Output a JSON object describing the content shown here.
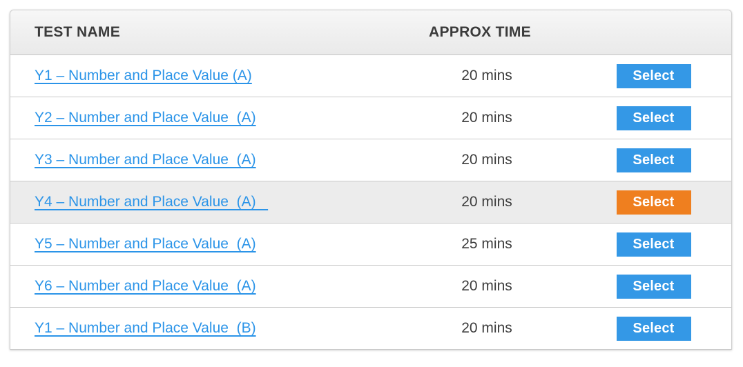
{
  "colors": {
    "link": "#2b94e8",
    "button_default": "#3498e6",
    "button_active": "#ef7f1f",
    "header_text": "#3b3b3b",
    "row_hover": "#ececec",
    "panel_border": "#cfcfcf"
  },
  "table": {
    "headers": {
      "test_name": "TEST NAME",
      "approx_time": "APPROX TIME"
    },
    "rows": [
      {
        "test_name": "Y1 – Number and Place Value (A)",
        "approx_time": "20 mins",
        "action_label": "Select",
        "state": "default"
      },
      {
        "test_name": "Y2 – Number and Place Value  (A)",
        "approx_time": "20 mins",
        "action_label": "Select",
        "state": "default"
      },
      {
        "test_name": "Y3 – Number and Place Value  (A)",
        "approx_time": "20 mins",
        "action_label": "Select",
        "state": "default"
      },
      {
        "test_name": "Y4 – Number and Place Value  (A)   ",
        "approx_time": "20 mins",
        "action_label": "Select",
        "state": "hover"
      },
      {
        "test_name": "Y5 – Number and Place Value  (A)",
        "approx_time": "25 mins",
        "action_label": "Select",
        "state": "default"
      },
      {
        "test_name": "Y6 – Number and Place Value  (A)",
        "approx_time": "20 mins",
        "action_label": "Select",
        "state": "default"
      },
      {
        "test_name": "Y1 – Number and Place Value  (B)",
        "approx_time": "20 mins",
        "action_label": "Select",
        "state": "default"
      }
    ]
  }
}
